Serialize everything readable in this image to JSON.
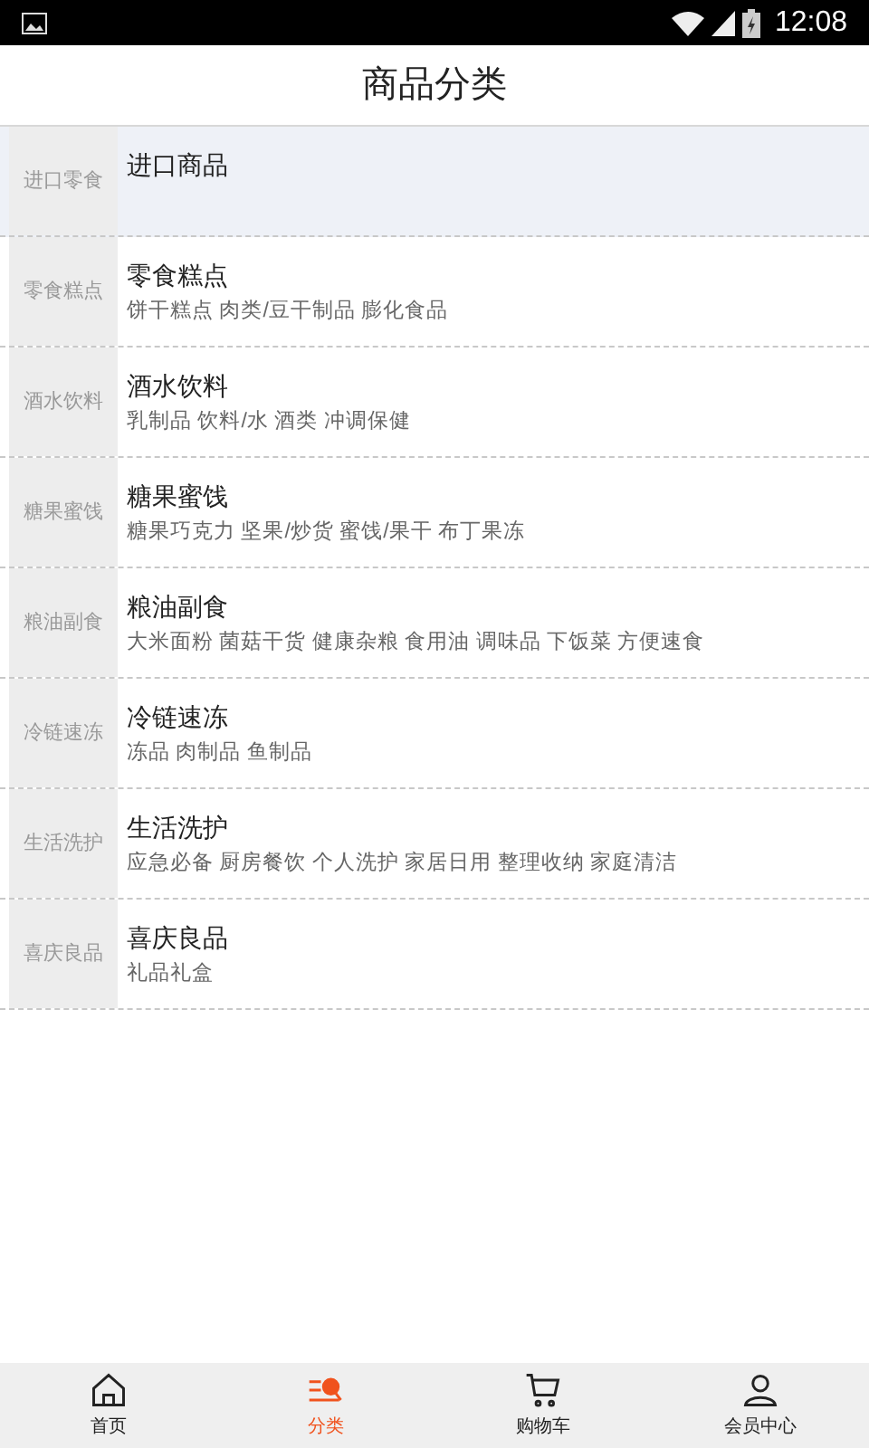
{
  "status_bar": {
    "time": "12:08"
  },
  "header": {
    "title": "商品分类"
  },
  "categories": [
    {
      "side_label": "进口零食",
      "title": "进口商品",
      "selected": true
    },
    {
      "side_label": "零食糕点",
      "title": "零食糕点",
      "subtitle": "饼干糕点 肉类/豆干制品 膨化食品",
      "selected": false
    },
    {
      "side_label": "酒水饮料",
      "title": "酒水饮料",
      "subtitle": "乳制品 饮料/水 酒类 冲调保健",
      "selected": false
    },
    {
      "side_label": "糖果蜜饯",
      "title": "糖果蜜饯",
      "subtitle": "糖果巧克力 坚果/炒货 蜜饯/果干 布丁果冻",
      "selected": false
    },
    {
      "side_label": "粮油副食",
      "title": "粮油副食",
      "subtitle": "大米面粉 菌菇干货 健康杂粮 食用油 调味品 下饭菜 方便速食",
      "selected": false
    },
    {
      "side_label": "冷链速冻",
      "title": "冷链速冻",
      "subtitle": "冻品 肉制品 鱼制品",
      "selected": false
    },
    {
      "side_label": "生活洗护",
      "title": "生活洗护",
      "subtitle": "应急必备 厨房餐饮 个人洗护 家居日用 整理收纳 家庭清洁",
      "selected": false
    },
    {
      "side_label": "喜庆良品",
      "title": "喜庆良品",
      "subtitle": "礼品礼盒",
      "selected": false
    }
  ],
  "bottom_nav": [
    {
      "label": "首页",
      "kind": "home",
      "selected": false
    },
    {
      "label": "分类",
      "kind": "category",
      "selected": true
    },
    {
      "label": "购物车",
      "kind": "cart",
      "selected": false
    },
    {
      "label": "会员中心",
      "kind": "user",
      "selected": false
    }
  ]
}
